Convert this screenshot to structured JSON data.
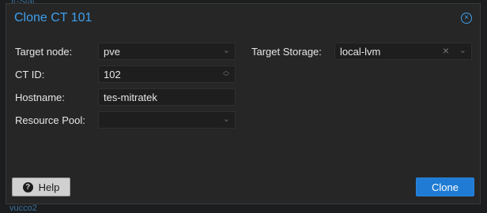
{
  "background": {
    "top_left_fragment": "I(-Stat",
    "bottom_left_fragment": "vucco2"
  },
  "dialog": {
    "title": "Clone CT 101"
  },
  "form": {
    "target_node": {
      "label": "Target node:",
      "value": "pve"
    },
    "ct_id": {
      "label": "CT ID:",
      "value": "102"
    },
    "hostname": {
      "label": "Hostname:",
      "value": "tes-mitratek"
    },
    "resource_pool": {
      "label": "Resource Pool:",
      "value": ""
    },
    "target_storage": {
      "label": "Target Storage:",
      "value": "local-lvm"
    }
  },
  "buttons": {
    "help": "Help",
    "clone": "Clone"
  },
  "colors": {
    "accent": "#3da0ef",
    "primary_button": "#1f7bd4",
    "dialog_background": "#262626",
    "field_background": "#1e1e1e"
  }
}
